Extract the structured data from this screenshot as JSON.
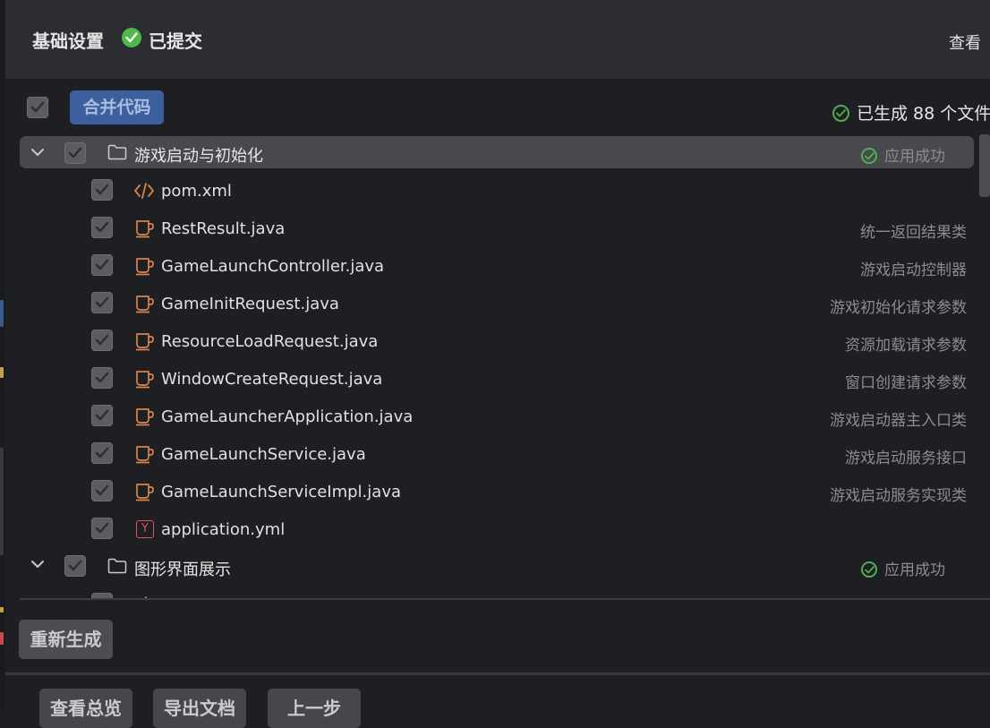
{
  "header": {
    "title": "基础设置",
    "status": "已提交",
    "view_link": "查看"
  },
  "toolbar": {
    "merge_button": "合并代码",
    "generated_status": "已生成 88 个文件"
  },
  "tree": {
    "groups": [
      {
        "name": "游戏启动与初始化",
        "status": "应用成功",
        "files": [
          {
            "name": "pom.xml",
            "desc": "",
            "icon": "xml-code-icon"
          },
          {
            "name": "RestResult.java",
            "desc": "统一返回结果类",
            "icon": "java-cup-icon"
          },
          {
            "name": "GameLaunchController.java",
            "desc": "游戏启动控制器",
            "icon": "java-cup-icon"
          },
          {
            "name": "GameInitRequest.java",
            "desc": "游戏初始化请求参数",
            "icon": "java-cup-icon"
          },
          {
            "name": "ResourceLoadRequest.java",
            "desc": "资源加载请求参数",
            "icon": "java-cup-icon"
          },
          {
            "name": "WindowCreateRequest.java",
            "desc": "窗口创建请求参数",
            "icon": "java-cup-icon"
          },
          {
            "name": "GameLauncherApplication.java",
            "desc": "游戏启动器主入口类",
            "icon": "java-cup-icon"
          },
          {
            "name": "GameLaunchService.java",
            "desc": "游戏启动服务接口",
            "icon": "java-cup-icon"
          },
          {
            "name": "GameLaunchServiceImpl.java",
            "desc": "游戏启动服务实现类",
            "icon": "java-cup-icon"
          },
          {
            "name": "application.yml",
            "desc": "",
            "icon": "yaml-icon",
            "icon_letter": "Y"
          }
        ]
      },
      {
        "name": "图形界面展示",
        "status": "应用成功",
        "files": []
      }
    ]
  },
  "actions": {
    "regenerate": "重新生成",
    "view_summary": "查看总览",
    "export_docs": "导出文档",
    "previous": "上一步"
  },
  "colors": {
    "background": "#1e1f22",
    "header_bg": "#2b2d30",
    "success_green": "#4fb84a",
    "primary_button": "#3d5f9e",
    "java_icon": "#d9844a",
    "yaml_icon": "#d9545f"
  }
}
